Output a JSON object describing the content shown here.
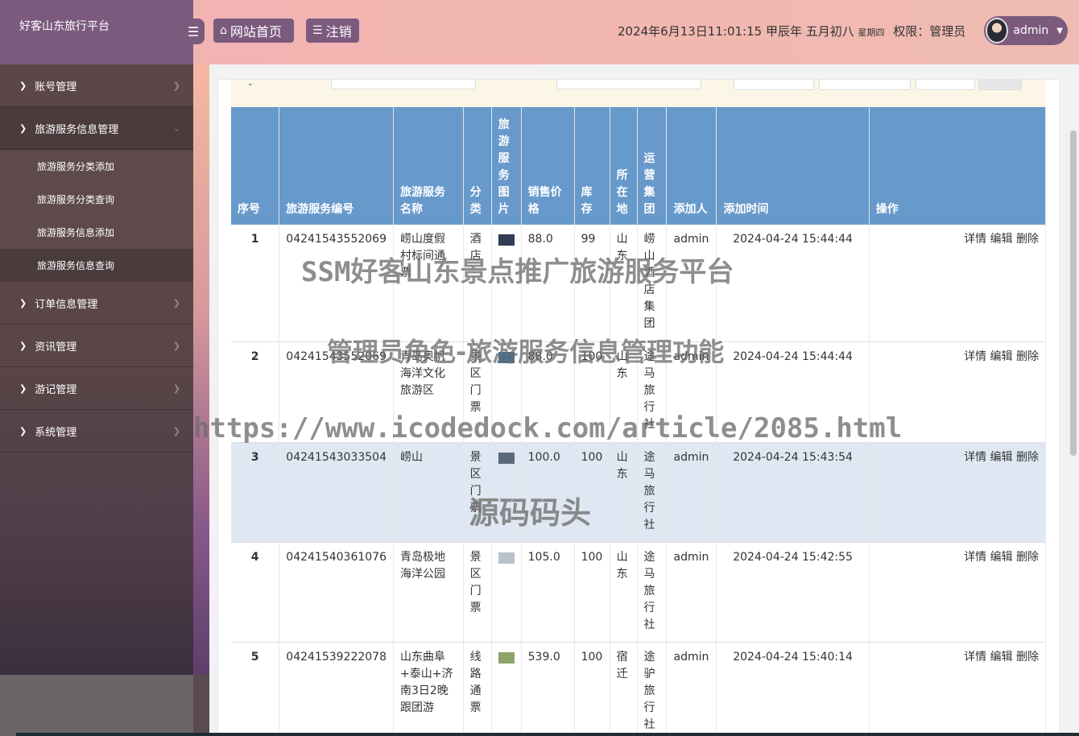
{
  "brand": {
    "title": "好客山东旅行平台"
  },
  "header": {
    "home_label": "网站首页",
    "logout_label": "注销",
    "datetime": "2024年6月13日11:01:15 甲辰年 五月初八",
    "weekday": "星期四",
    "role_text": "权限：管理员",
    "username": "admin"
  },
  "sidebar": {
    "items": [
      {
        "label": "账号管理"
      },
      {
        "label": "旅游服务信息管理"
      },
      {
        "label": "订单信息管理"
      },
      {
        "label": "资讯管理"
      },
      {
        "label": "游记管理"
      },
      {
        "label": "系统管理"
      }
    ],
    "subitems": [
      {
        "label": "旅游服务分类添加"
      },
      {
        "label": "旅游服务分类查询"
      },
      {
        "label": "旅游服务信息添加"
      },
      {
        "label": "旅游服务信息查询"
      }
    ]
  },
  "table": {
    "headers": [
      "序号",
      "旅游服务编号",
      "旅游服务名称",
      "分类",
      "旅游服务图片",
      "销售价格",
      "库存",
      "所在地",
      "运营集团",
      "添加人",
      "添加时间",
      "操作"
    ],
    "ops": {
      "detail": "详情",
      "edit": "编辑",
      "delete": "删除"
    },
    "rows": [
      {
        "idx": "1",
        "code": "04241543552069",
        "name": "崂山度假村标间通票",
        "category": "酒店",
        "thumb_color": "#2f3d55",
        "price": "88.0",
        "stock": "99",
        "location": "山东",
        "group": "崂山酒店集团",
        "adder": "admin",
        "time": "2024-04-24 15:44:44"
      },
      {
        "idx": "2",
        "code": "04241543552069",
        "name": "青岛奥帆海洋文化旅游区",
        "category": "景区门票",
        "thumb_color": "#3f6f93",
        "price": "88.0",
        "stock": "100",
        "location": "山东",
        "group": "途马旅行社",
        "adder": "admin",
        "time": "2024-04-24 15:44:44"
      },
      {
        "idx": "3",
        "code": "04241543033504",
        "name": "崂山",
        "category": "景区门票",
        "thumb_color": "#5b6a7a",
        "price": "100.0",
        "stock": "100",
        "location": "山东",
        "group": "途马旅行社",
        "adder": "admin",
        "time": "2024-04-24 15:43:54"
      },
      {
        "idx": "4",
        "code": "04241540361076",
        "name": "青岛极地海洋公园",
        "category": "景区门票",
        "thumb_color": "#b8c2cc",
        "price": "105.0",
        "stock": "100",
        "location": "山东",
        "group": "途马旅行社",
        "adder": "admin",
        "time": "2024-04-24 15:42:55"
      },
      {
        "idx": "5",
        "code": "04241539222078",
        "name": "山东曲阜+泰山+济南3日2晚跟团游",
        "category": "线路通票",
        "thumb_color": "#8aa46a",
        "price": "539.0",
        "stock": "100",
        "location": "宿迁",
        "group": "途驴旅行社",
        "adder": "admin",
        "time": "2024-04-24 15:40:14"
      }
    ]
  },
  "watermark": {
    "line1": "SSM好客山东景点推广旅游服务平台",
    "line2": "管理员角色-旅游服务信息管理功能",
    "line3": "https://www.icodedock.com/article/2085.html",
    "line4": "源码码头"
  },
  "colors": {
    "accent": "#7c5a7e",
    "table_header": "#6799cb",
    "highlight_row": "#dfe8f2"
  }
}
